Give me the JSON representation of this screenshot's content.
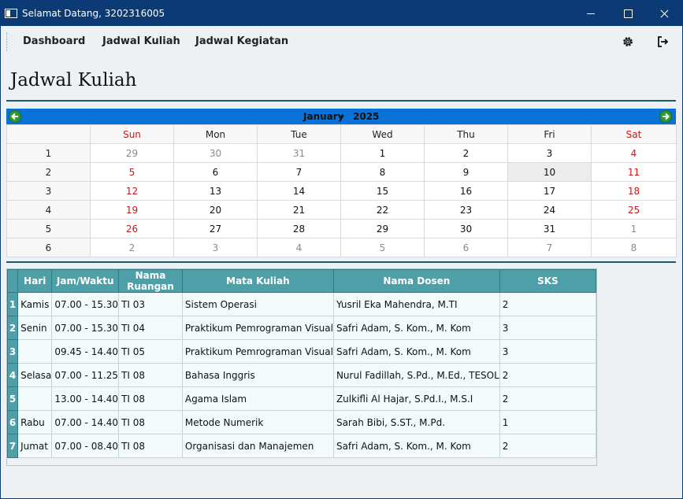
{
  "window": {
    "title": "Selamat Datang, 3202316005"
  },
  "menu": {
    "items": [
      "Dashboard",
      "Jadwal Kuliah",
      "Jadwal Kegiatan"
    ],
    "icons": [
      "gear-icon",
      "logout-icon"
    ]
  },
  "page": {
    "title": "Jadwal Kuliah"
  },
  "calendar": {
    "month": "January",
    "year": "2025",
    "weekdays": [
      "Sun",
      "Mon",
      "Tue",
      "Wed",
      "Thu",
      "Fri",
      "Sat"
    ],
    "weeks": [
      {
        "week": "1",
        "days": [
          "29",
          "30",
          "31",
          "1",
          "2",
          "3",
          "4"
        ]
      },
      {
        "week": "2",
        "days": [
          "5",
          "6",
          "7",
          "8",
          "9",
          "10",
          "11"
        ]
      },
      {
        "week": "3",
        "days": [
          "12",
          "13",
          "14",
          "15",
          "16",
          "17",
          "18"
        ]
      },
      {
        "week": "4",
        "days": [
          "19",
          "20",
          "21",
          "22",
          "23",
          "24",
          "25"
        ]
      },
      {
        "week": "5",
        "days": [
          "26",
          "27",
          "28",
          "29",
          "30",
          "31",
          "1"
        ]
      },
      {
        "week": "6",
        "days": [
          "2",
          "3",
          "4",
          "5",
          "6",
          "7",
          "8"
        ]
      }
    ],
    "selected_day": "10",
    "colors": {
      "nav": "#0a72d6",
      "weekend": "#c81818",
      "muted": "#8a8a8a"
    }
  },
  "schedule": {
    "headers": [
      "Hari",
      "Jam/Waktu",
      "Nama Ruangan",
      "Mata Kuliah",
      "Nama Dosen",
      "SKS"
    ],
    "rows": [
      {
        "no": "1",
        "hari": "Kamis",
        "jam": "07.00 - 15.30",
        "ruang": "TI 03",
        "mk": "Sistem Operasi",
        "dosen": "Yusril Eka Mahendra, M.TI",
        "sks": "2"
      },
      {
        "no": "2",
        "hari": "Senin",
        "jam": "07.00 - 15.30",
        "ruang": "TI 04",
        "mk": "Praktikum Pemrograman Visual",
        "dosen": "Safri Adam, S. Kom., M. Kom",
        "sks": "3"
      },
      {
        "no": "3",
        "hari": "",
        "jam": "09.45 - 14.40",
        "ruang": "TI 05",
        "mk": "Praktikum Pemrograman Visual",
        "dosen": "Safri Adam, S. Kom., M. Kom",
        "sks": "3"
      },
      {
        "no": "4",
        "hari": "Selasa",
        "jam": "07.00 - 11.25",
        "ruang": "TI 08",
        "mk": "Bahasa Inggris",
        "dosen": "Nurul Fadillah, S.Pd., M.Ed., TESOL",
        "sks": "2"
      },
      {
        "no": "5",
        "hari": "",
        "jam": "13.00 - 14.40",
        "ruang": "TI 08",
        "mk": "Agama Islam",
        "dosen": "Zulkifli Al Hajar, S.Pd.I., M.S.I",
        "sks": "2"
      },
      {
        "no": "6",
        "hari": "Rabu",
        "jam": "07.00 - 14.40",
        "ruang": "TI 08",
        "mk": "Metode Numerik",
        "dosen": "Sarah Bibi, S.ST., M.Pd.",
        "sks": "1"
      },
      {
        "no": "7",
        "hari": "Jumat",
        "jam": "07.00 - 08.40",
        "ruang": "TI 08",
        "mk": "Organisasi dan Manajemen",
        "dosen": "Safri Adam, S. Kom., M. Kom",
        "sks": "2"
      }
    ],
    "header_color": "#4f9fa8"
  }
}
